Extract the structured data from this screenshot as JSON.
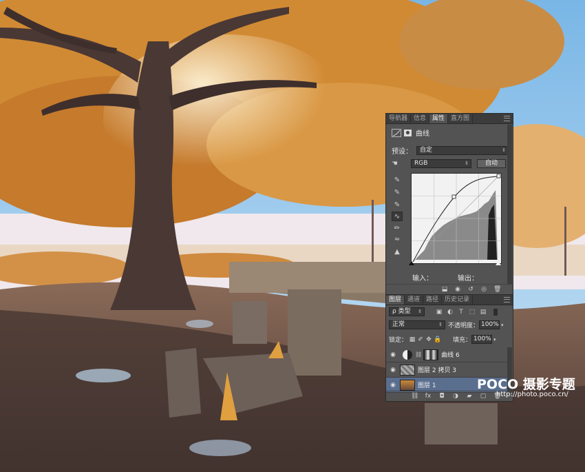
{
  "properties_panel": {
    "tabs": [
      "导航器",
      "信息",
      "属性",
      "直方图"
    ],
    "active_tab": 2,
    "header_title": "曲线",
    "preset_label": "预设：",
    "preset_value": "自定",
    "channel_value": "RGB",
    "auto_button": "自动",
    "input_label": "输入：",
    "output_label": "输出："
  },
  "layers_panel": {
    "tabs": [
      "图层",
      "通道",
      "路径",
      "历史记录"
    ],
    "active_tab": 0,
    "filter_value": "ρ 类型",
    "blend_mode": "正常",
    "opacity_label": "不透明度：",
    "opacity_value": "100%",
    "lock_label": "锁定：",
    "fill_label": "填充：",
    "fill_value": "100%",
    "layers": [
      {
        "name": "曲线 6",
        "type": "adjustment",
        "selected": false
      },
      {
        "name": "图层 2 拷贝 3",
        "type": "image",
        "selected": false
      },
      {
        "name": "图层 1",
        "type": "image",
        "selected": true
      }
    ]
  },
  "watermark": {
    "brand": "POCO 摄影专题",
    "url": "http://photo.poco.cn/"
  },
  "colors": {
    "panel_bg": "#535353",
    "tab_bg": "#3c3c3c",
    "selected_layer": "#5a6e8e",
    "sky": "#6aaee0",
    "foliage": "#d88a2c"
  }
}
